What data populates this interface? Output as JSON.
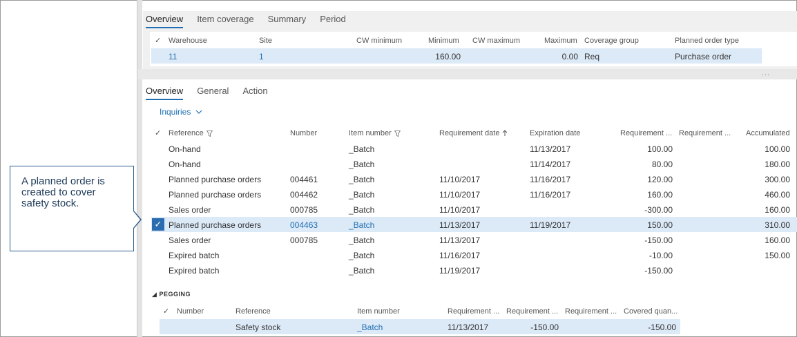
{
  "callout": {
    "text": "A planned order is created to cover safety stock."
  },
  "top_tabs": [
    "Overview",
    "Item coverage",
    "Summary",
    "Period"
  ],
  "coverage": {
    "headers": [
      "Warehouse",
      "Site",
      "CW minimum",
      "Minimum",
      "CW maximum",
      "Maximum",
      "Coverage group",
      "Planned order type"
    ],
    "row": [
      "11",
      "1",
      "",
      "160.00",
      "",
      "0.00",
      "Req",
      "Purchase order"
    ]
  },
  "more": "...",
  "lower_tabs": [
    "Overview",
    "General",
    "Action"
  ],
  "inquiries": "Inquiries",
  "transactions": {
    "headers": [
      "Reference",
      "Number",
      "Item number",
      "Requirement date",
      "Expiration date",
      "Requirement ...",
      "Requirement ...",
      "Accumulated"
    ],
    "rows": [
      [
        "On-hand",
        "",
        "_Batch",
        "",
        "11/13/2017",
        "100.00",
        "",
        "100.00"
      ],
      [
        "On-hand",
        "",
        "_Batch",
        "",
        "11/14/2017",
        "80.00",
        "",
        "180.00"
      ],
      [
        "Planned purchase orders",
        "004461",
        "_Batch",
        "11/10/2017",
        "11/16/2017",
        "120.00",
        "",
        "300.00"
      ],
      [
        "Planned purchase orders",
        "004462",
        "_Batch",
        "11/10/2017",
        "11/16/2017",
        "160.00",
        "",
        "460.00"
      ],
      [
        "Sales order",
        "000785",
        "_Batch",
        "11/10/2017",
        "",
        "-300.00",
        "",
        "160.00"
      ],
      [
        "Planned purchase orders",
        "004463",
        "_Batch",
        "11/13/2017",
        "11/19/2017",
        "150.00",
        "",
        "310.00"
      ],
      [
        "Sales order",
        "000785",
        "_Batch",
        "11/13/2017",
        "",
        "-150.00",
        "",
        "160.00"
      ],
      [
        "Expired batch",
        "",
        "_Batch",
        "11/16/2017",
        "",
        "-10.00",
        "",
        "150.00"
      ],
      [
        "Expired batch",
        "",
        "_Batch",
        "11/19/2017",
        "",
        "-150.00",
        "",
        ""
      ]
    ]
  },
  "pegging": {
    "title": "PEGGING",
    "headers": [
      "Number",
      "Reference",
      "Item number",
      "Requirement ...",
      "Requirement ...",
      "Requirement ...",
      "Covered quan..."
    ],
    "row": [
      "",
      "Safety stock",
      "_Batch",
      "11/13/2017",
      "-150.00",
      "",
      "-150.00"
    ]
  },
  "colors": {
    "accent": "#1f6fb2",
    "selection": "#dce9f7",
    "callout_border": "#2b5c8a"
  }
}
